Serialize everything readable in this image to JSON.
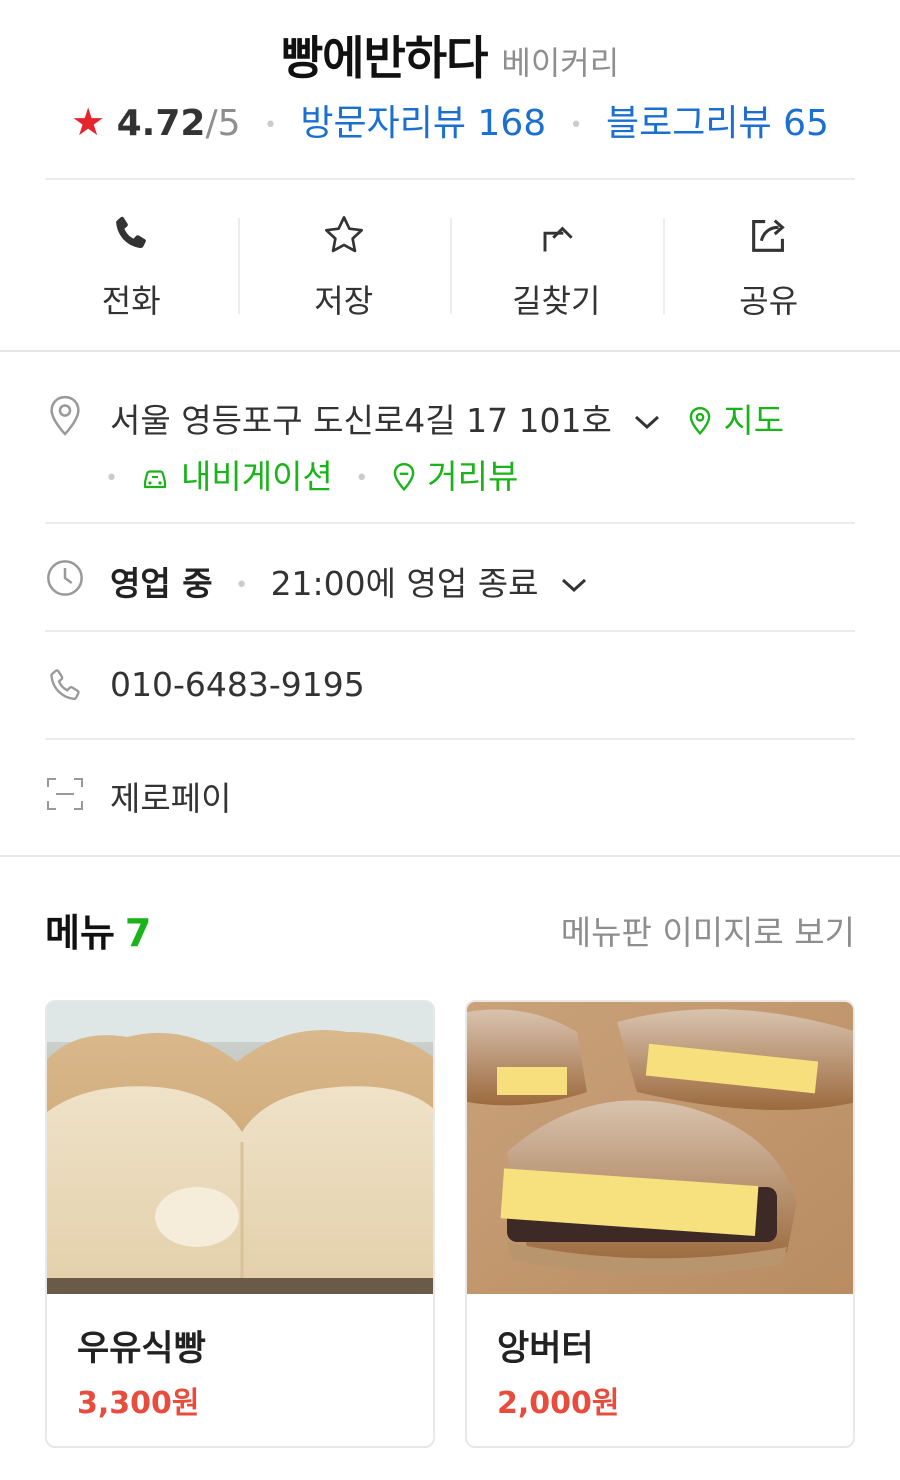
{
  "place": {
    "name": "빵에반하다",
    "category": "베이커리",
    "rating": "4.72",
    "rating_max": "/5",
    "visitor_reviews": "방문자리뷰 168",
    "blog_reviews": "블로그리뷰 65"
  },
  "actions": [
    {
      "label": "전화",
      "icon": "phone-icon"
    },
    {
      "label": "저장",
      "icon": "star-outline-icon"
    },
    {
      "label": "길찾기",
      "icon": "directions-icon"
    },
    {
      "label": "공유",
      "icon": "share-icon"
    }
  ],
  "address": {
    "text": "서울 영등포구 도신로4길 17 101호",
    "map_label": "지도",
    "navigation_label": "내비게이션",
    "street_view_label": "거리뷰"
  },
  "hours": {
    "status": "영업 중",
    "detail": "21:00에 영업 종료"
  },
  "phone": {
    "number": "010-6483-9195"
  },
  "payment": {
    "label": "제로페이"
  },
  "menu": {
    "title": "메뉴",
    "count": "7",
    "board_link": "메뉴판 이미지로 보기",
    "items": [
      {
        "name": "우유식빵",
        "price": "3,300원"
      },
      {
        "name": "앙버터",
        "price": "2,000원"
      }
    ]
  },
  "colors": {
    "link_blue": "#1a6fd0",
    "green": "#1bb31a",
    "star_red": "#e6242e",
    "price_red": "#e84c3d"
  }
}
